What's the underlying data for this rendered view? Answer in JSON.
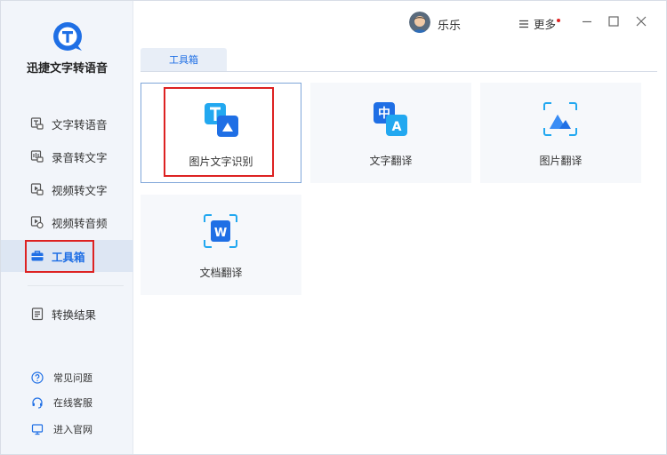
{
  "app": {
    "name": "迅捷文字转语音"
  },
  "sidebar": {
    "items": [
      {
        "label": "文字转语音",
        "icon": "text-to-speech-icon"
      },
      {
        "label": "录音转文字",
        "icon": "recording-to-text-icon"
      },
      {
        "label": "视频转文字",
        "icon": "video-to-text-icon"
      },
      {
        "label": "视频转音频",
        "icon": "video-to-audio-icon"
      },
      {
        "label": "工具箱",
        "icon": "toolbox-icon",
        "active": true
      },
      {
        "label": "转换结果",
        "icon": "results-icon"
      }
    ],
    "footer": [
      {
        "label": "常见问题",
        "icon": "help-icon"
      },
      {
        "label": "在线客服",
        "icon": "headset-icon"
      },
      {
        "label": "进入官网",
        "icon": "monitor-icon"
      }
    ]
  },
  "header": {
    "username": "乐乐",
    "more_label": "更多"
  },
  "tabs": [
    {
      "label": "工具箱"
    }
  ],
  "tools": [
    {
      "label": "图片文字识别",
      "icon": "image-ocr-icon",
      "selected": true
    },
    {
      "label": "文字翻译",
      "icon": "text-translate-icon"
    },
    {
      "label": "图片翻译",
      "icon": "image-translate-icon"
    },
    {
      "label": "文档翻译",
      "icon": "document-translate-icon"
    }
  ],
  "colors": {
    "accent": "#1f6fe5",
    "highlight": "#dd2222",
    "sidebar_bg": "#f2f5fa"
  }
}
